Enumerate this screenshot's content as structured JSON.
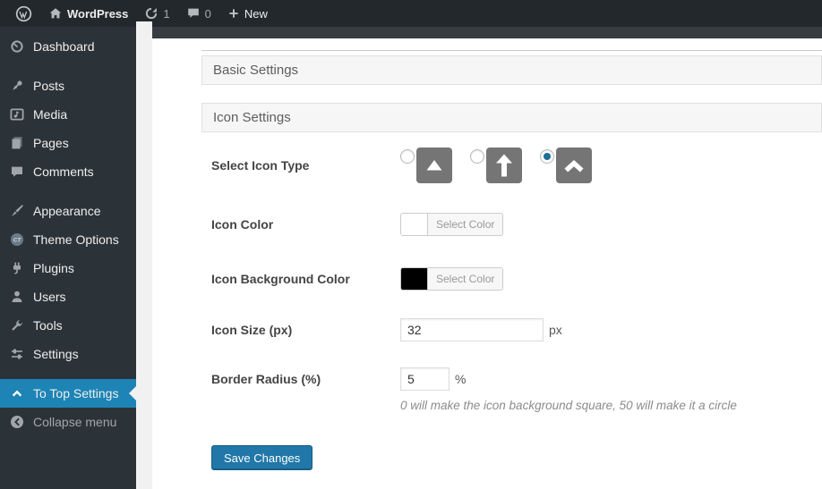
{
  "admin_bar": {
    "site_name": "WordPress",
    "update_count": "1",
    "comment_count": "0",
    "new_label": "New"
  },
  "sidebar": {
    "items": [
      {
        "label": "Dashboard",
        "icon": "dashboard-icon",
        "active": false
      },
      {
        "label": "Posts",
        "icon": "posts-pin-icon",
        "active": false
      },
      {
        "label": "Media",
        "icon": "media-icon",
        "active": false
      },
      {
        "label": "Pages",
        "icon": "pages-icon",
        "active": false
      },
      {
        "label": "Comments",
        "icon": "comments-icon",
        "active": false
      },
      {
        "label": "Appearance",
        "icon": "appearance-brush-icon",
        "active": false
      },
      {
        "label": "Theme Options",
        "icon": "theme-options-ct-icon",
        "active": false
      },
      {
        "label": "Plugins",
        "icon": "plugins-plug-icon",
        "active": false
      },
      {
        "label": "Users",
        "icon": "users-icon",
        "active": false
      },
      {
        "label": "Tools",
        "icon": "tools-wrench-icon",
        "active": false
      },
      {
        "label": "Settings",
        "icon": "settings-sliders-icon",
        "active": false
      },
      {
        "label": "To Top Settings",
        "icon": "chevron-up-icon",
        "active": true
      },
      {
        "label": "Collapse menu",
        "icon": "collapse-arrow-icon",
        "active": false
      }
    ]
  },
  "panels": {
    "basic": {
      "title": "Basic Settings"
    },
    "icon": {
      "title": "Icon Settings"
    }
  },
  "form": {
    "select_icon_type": {
      "label": "Select Icon Type",
      "options": [
        {
          "name": "triangle-up",
          "selected": false
        },
        {
          "name": "arrow-up",
          "selected": false
        },
        {
          "name": "chevron-up",
          "selected": true
        }
      ]
    },
    "icon_color": {
      "label": "Icon Color",
      "value": "#ffffff",
      "button": "Select Color"
    },
    "icon_bg_color": {
      "label": "Icon Background Color",
      "value": "#000000",
      "button": "Select Color"
    },
    "icon_size": {
      "label": "Icon Size (px)",
      "value": "32",
      "suffix": "px"
    },
    "border_radius": {
      "label": "Border Radius (%)",
      "value": "5",
      "suffix": "%",
      "hint": "0 will make the icon background square, 50 will make it a circle"
    },
    "save_button": "Save Changes"
  },
  "icons": {
    "wordpress-logo": "W in circle",
    "home-icon": "house",
    "update-icon": "circular refresh arrow",
    "comment-bubble-icon": "speech bubble",
    "plus-icon": "+",
    "dashboard-icon": "gauge",
    "posts-pin-icon": "pushpin",
    "media-icon": "framed music note",
    "pages-icon": "stacked pages",
    "comments-icon": "speech bubble",
    "appearance-brush-icon": "paintbrush",
    "theme-options-ct-icon": "CT circle badge",
    "plugins-plug-icon": "power plug",
    "users-icon": "person silhouette",
    "tools-wrench-icon": "wrench",
    "settings-sliders-icon": "sliders",
    "chevron-up-icon": "^",
    "collapse-arrow-icon": "circled left arrow",
    "triangle-up-icon": "▲",
    "arrow-up-icon": "↑"
  },
  "colors": {
    "admin_bar_bg": "#23282d",
    "sidebar_bg": "#2c3338",
    "active_menu_bg": "#1d84b5",
    "content_strip": "#373c41",
    "accordion_bg": "#f6f6f6",
    "icon_square_bg": "#757575",
    "button_primary_bg": "#2077a8",
    "radio_selected_dot": "#1d6f95"
  }
}
